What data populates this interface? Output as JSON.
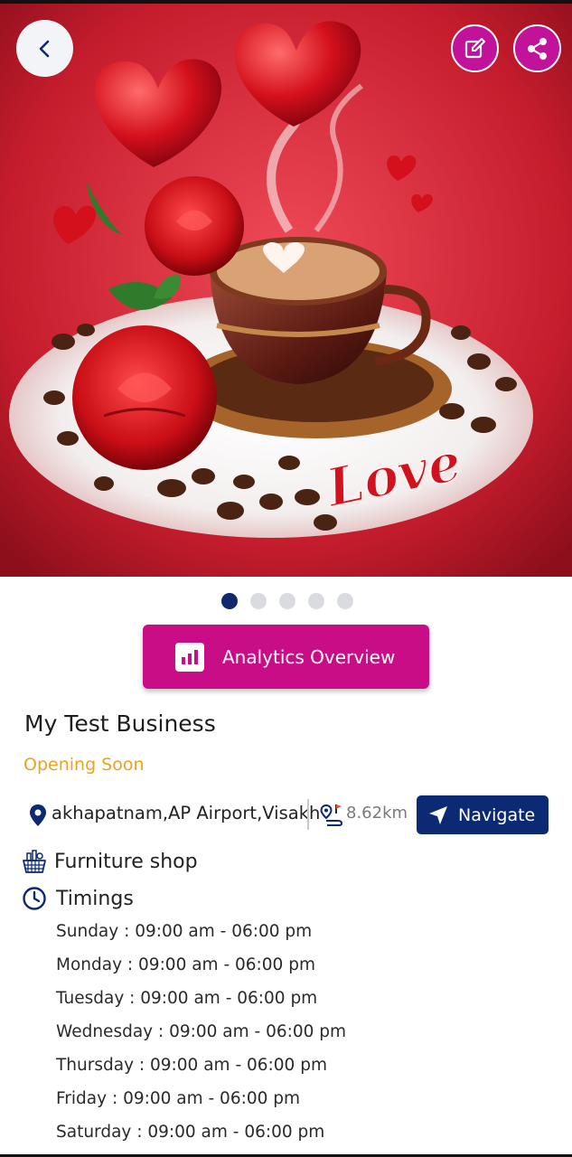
{
  "hero": {
    "image_label": "Love",
    "carousel_total": 5,
    "carousel_active": 1
  },
  "actions": {
    "analytics_label": "Analytics Overview"
  },
  "business": {
    "name": "My Test Business",
    "status": "Opening Soon",
    "address": "akhapatnam,AP Airport,Visakhapatnam",
    "distance": "8.62km",
    "navigate_label": "Navigate",
    "category": "Furniture shop",
    "timings_label": "Timings",
    "hours": [
      "Sunday : 09:00 am - 06:00 pm",
      "Monday : 09:00 am - 06:00 pm",
      "Tuesday : 09:00 am - 06:00 pm",
      "Wednesday : 09:00 am - 06:00 pm",
      "Thursday : 09:00 am - 06:00 pm",
      "Friday : 09:00 am - 06:00 pm",
      "Saturday : 09:00 am - 06:00 pm"
    ]
  },
  "colors": {
    "brand_magenta": "#c90d86",
    "navy": "#0b2a73",
    "status_orange": "#eda11d"
  }
}
